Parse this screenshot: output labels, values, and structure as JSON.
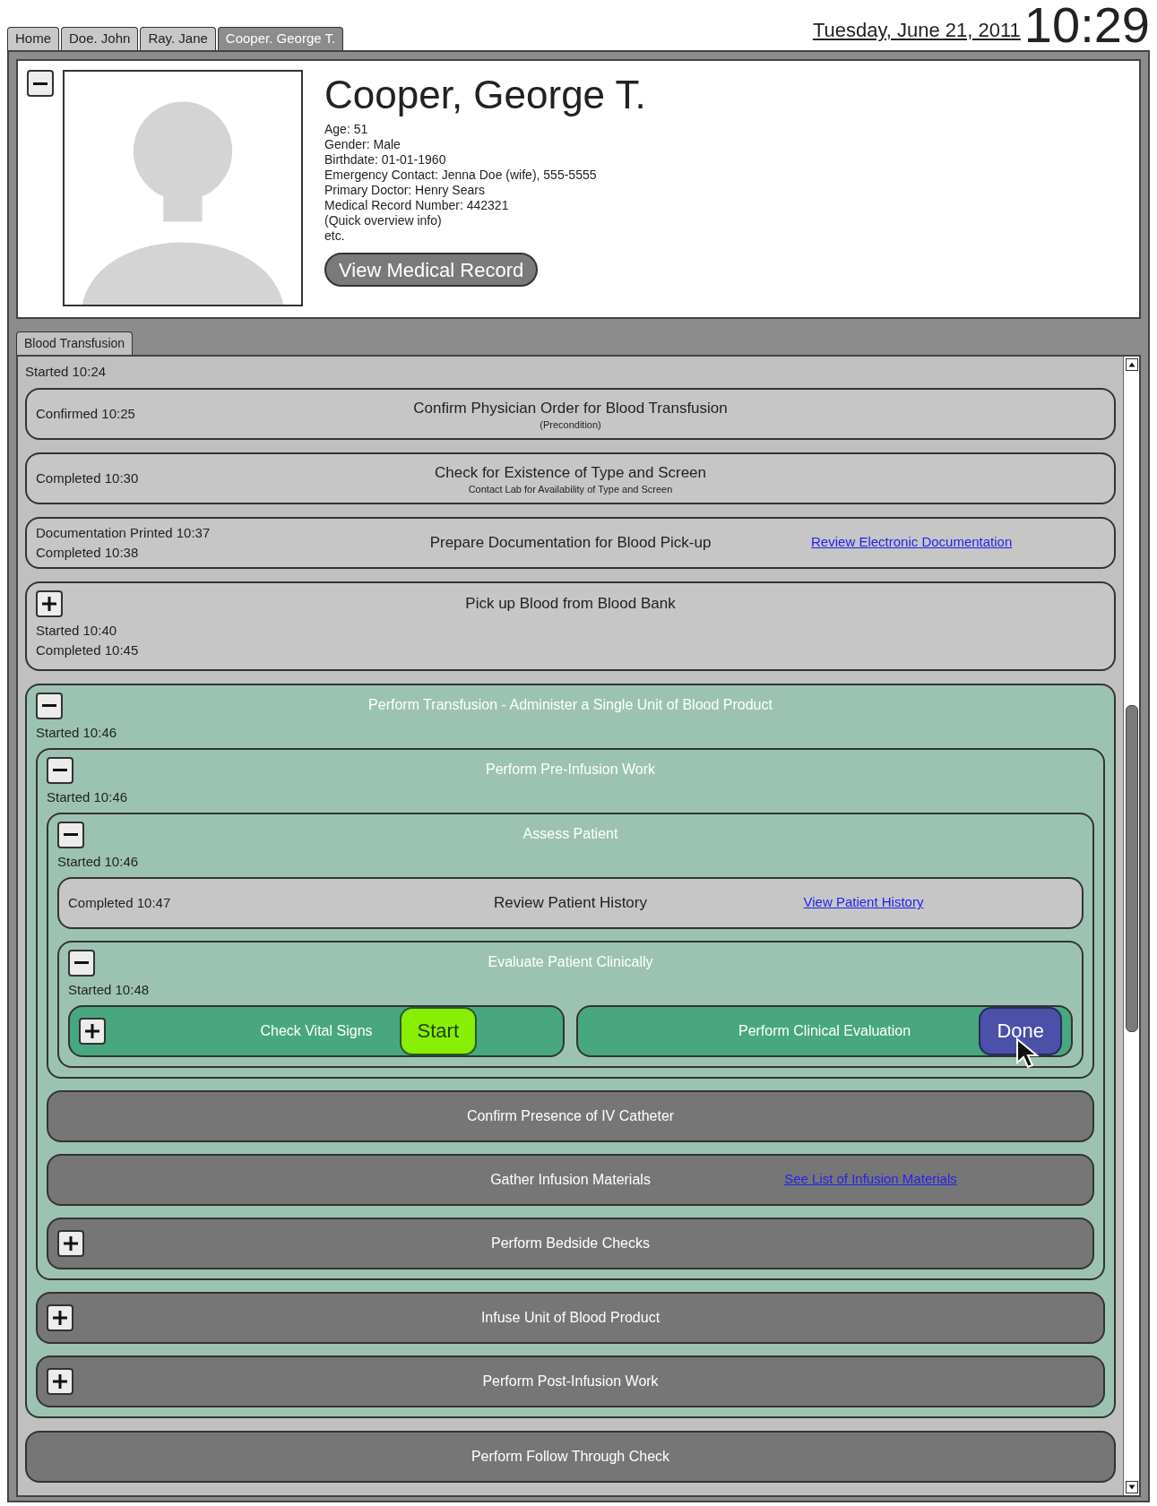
{
  "tabs": [
    {
      "label": "Home",
      "selected": false
    },
    {
      "label": "Doe. John",
      "selected": false
    },
    {
      "label": "Ray. Jane",
      "selected": false
    },
    {
      "label": "Cooper. George T.",
      "selected": true
    }
  ],
  "date": "Tuesday, June 21, 2011",
  "time": "10:29",
  "patient": {
    "name": "Cooper, George T.",
    "expanded": true,
    "info": [
      "Age: 51",
      "Gender: Male",
      "Birthdate: 01-01-1960",
      "Emergency Contact: Jenna Doe (wife), 555-5555",
      "Primary Doctor: Henry Sears",
      "Medical Record Number: 442321",
      "(Quick overview info)",
      "etc."
    ],
    "button": "View Medical Record"
  },
  "procedure_tabs": [
    {
      "label": "Blood Transfusion",
      "selected": true
    }
  ],
  "procedure": {
    "status": "Started 10:24",
    "tasks": [
      {
        "kind": "done",
        "title": "Confirm Physician Order for Blood Transfusion",
        "subtitle": "(Precondition)",
        "status": [
          "Confirmed 10:25"
        ]
      },
      {
        "kind": "done",
        "title": "Check for Existence of Type and Screen",
        "subtitle": "Contact Lab for Availability of Type and Screen",
        "status": [
          "Completed 10:30"
        ]
      },
      {
        "kind": "done",
        "title": "Prepare Documentation for Blood Pick-up",
        "status": [
          "Documentation Printed 10:37",
          "Completed 10:38"
        ],
        "link": "Review Electronic Documentation"
      },
      {
        "kind": "done",
        "expanded": false,
        "title": "Pick up Blood from Blood Bank",
        "status": [
          "Started 10:40",
          "Completed 10:45"
        ]
      },
      {
        "kind": "active",
        "expanded": true,
        "title": "Perform Transfusion - Administer a Single Unit of Blood Product",
        "status": [
          "Started 10:46"
        ],
        "children": [
          {
            "kind": "active",
            "expanded": true,
            "title": "Perform Pre-Infusion Work",
            "status": [
              "Started 10:46"
            ],
            "children": [
              {
                "kind": "active",
                "expanded": true,
                "title": "Assess Patient",
                "status": [
                  "Started 10:46"
                ],
                "children": [
                  {
                    "kind": "done",
                    "title": "Review Patient History",
                    "status": [
                      "Completed 10:47"
                    ],
                    "link": "View Patient History"
                  },
                  {
                    "kind": "active",
                    "expanded": true,
                    "title": "Evaluate Patient Clinically",
                    "status": [
                      "Started 10:48"
                    ],
                    "children": [
                      {
                        "kind": "current",
                        "expanded": false,
                        "title": "Check Vital Signs",
                        "action": {
                          "kind": "start",
                          "label": "Start"
                        }
                      },
                      {
                        "kind": "current",
                        "title": "Perform Clinical Evaluation",
                        "action": {
                          "kind": "done",
                          "label": "Done"
                        }
                      }
                    ]
                  }
                ]
              },
              {
                "kind": "pending",
                "title": "Confirm Presence of IV Catheter"
              },
              {
                "kind": "pending",
                "title": "Gather Infusion Materials",
                "link": "See List of Infusion Materials"
              },
              {
                "kind": "pending",
                "expanded": false,
                "title": "Perform Bedside Checks"
              }
            ]
          },
          {
            "kind": "pending",
            "expanded": false,
            "title": "Infuse Unit of Blood Product"
          },
          {
            "kind": "pending",
            "expanded": false,
            "title": "Perform Post-Infusion Work"
          }
        ]
      },
      {
        "kind": "pending",
        "title": "Perform Follow Through Check"
      }
    ]
  }
}
